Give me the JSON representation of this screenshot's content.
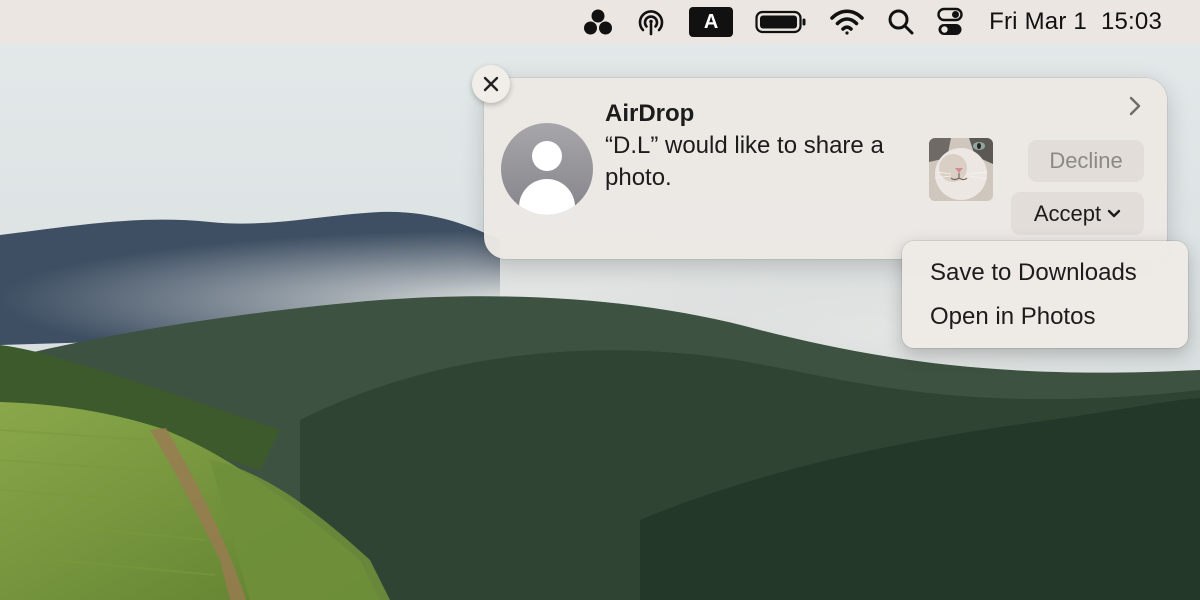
{
  "menubar": {
    "icons": [
      "group-activity-icon",
      "airdrop-icon",
      "input-source-icon",
      "battery-icon",
      "wifi-icon",
      "spotlight-search-icon",
      "control-center-icon"
    ],
    "input_source_label": "A",
    "date": "Fri Mar 1",
    "time": "15:03"
  },
  "notification": {
    "app": "AirDrop",
    "message": "“D.L” would like to share a photo.",
    "close_icon": "close-icon",
    "expand_icon": "chevron-right-icon",
    "avatar_icon": "person-icon",
    "thumbnail": "cat-photo-thumbnail",
    "decline_label": "Decline",
    "accept_label": "Accept"
  },
  "accept_menu": {
    "items": [
      "Save to Downloads",
      "Open in Photos"
    ]
  },
  "colors": {
    "menubar_bg": "#ebe6e1",
    "card_bg": "#ece8e4",
    "button_bg": "#e2ddd8",
    "disabled_text": "#8c8985"
  }
}
